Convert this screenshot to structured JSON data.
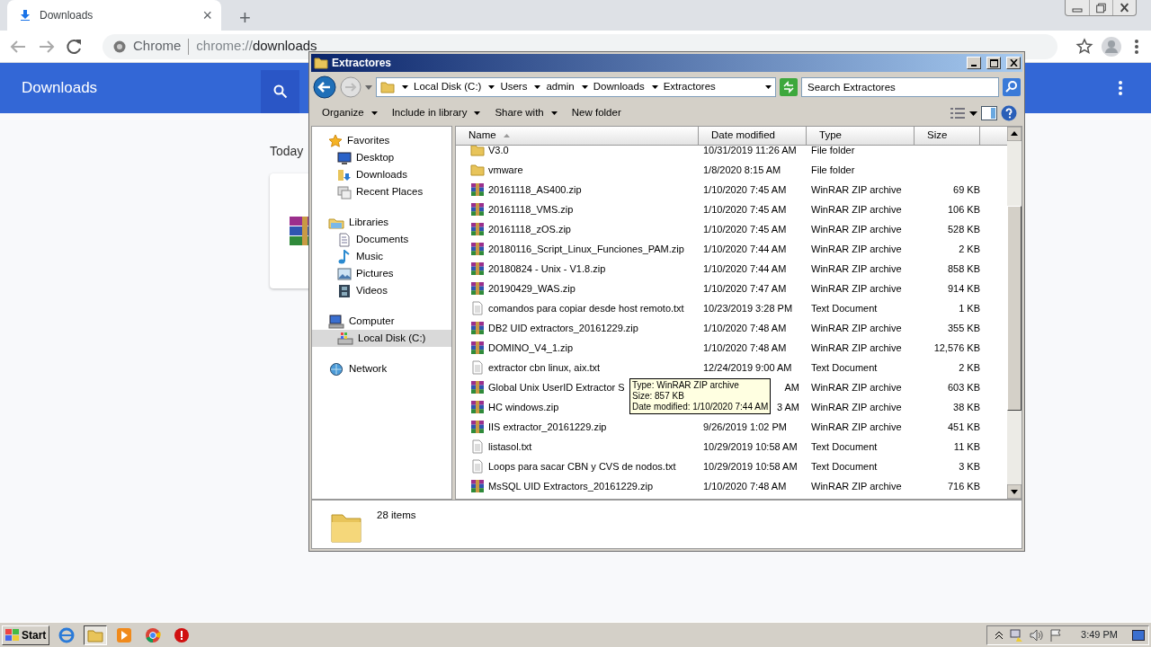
{
  "browser": {
    "tab": {
      "title": "Downloads",
      "close": "×"
    },
    "new_tab": "+",
    "omnibox": {
      "site_label": "Chrome",
      "url_scheme": "chrome://",
      "url_path": "downloads"
    },
    "page_title": "Downloads",
    "section": "Today"
  },
  "explorer": {
    "title": "Extractores",
    "breadcrumbs": [
      "Local Disk (C:)",
      "Users",
      "admin",
      "Downloads",
      "Extractores"
    ],
    "search": {
      "placeholder": "Search Extractores"
    },
    "toolbar": [
      {
        "label": "Organize",
        "dropdown": true
      },
      {
        "label": "Include in library",
        "dropdown": true
      },
      {
        "label": "Share with",
        "dropdown": true
      },
      {
        "label": "New folder",
        "dropdown": false
      }
    ],
    "nav": [
      {
        "label": "Favorites",
        "kind": "star",
        "children": [
          {
            "label": "Desktop",
            "kind": "desktop",
            "selected": false
          },
          {
            "label": "Downloads",
            "kind": "downloads",
            "selected": false
          },
          {
            "label": "Recent Places",
            "kind": "recent",
            "selected": false
          }
        ]
      },
      {
        "label": "Libraries",
        "kind": "libraries",
        "children": [
          {
            "label": "Documents",
            "kind": "document",
            "selected": false
          },
          {
            "label": "Music",
            "kind": "music",
            "selected": false
          },
          {
            "label": "Pictures",
            "kind": "pictures",
            "selected": false
          },
          {
            "label": "Videos",
            "kind": "videos",
            "selected": false
          }
        ]
      },
      {
        "label": "Computer",
        "kind": "computer",
        "children": [
          {
            "label": "Local Disk (C:)",
            "kind": "disk",
            "selected": true
          }
        ]
      },
      {
        "label": "Network",
        "kind": "network"
      }
    ],
    "columns": [
      "Name",
      "Date modified",
      "Type",
      "Size"
    ],
    "rows": [
      {
        "kind": "folder",
        "name": "V3.0",
        "date": "10/31/2019 11:26 AM",
        "type": "File folder"
      },
      {
        "kind": "folder",
        "name": "vmware",
        "date": "1/8/2020 8:15 AM",
        "type": "File folder"
      },
      {
        "kind": "zip",
        "name": "20161118_AS400.zip",
        "date": "1/10/2020 7:45 AM",
        "type": "WinRAR ZIP archive",
        "size": "69 KB"
      },
      {
        "kind": "zip",
        "name": "20161118_VMS.zip",
        "date": "1/10/2020 7:45 AM",
        "type": "WinRAR ZIP archive",
        "size": "106 KB"
      },
      {
        "kind": "zip",
        "name": "20161118_zOS.zip",
        "date": "1/10/2020 7:45 AM",
        "type": "WinRAR ZIP archive",
        "size": "528 KB"
      },
      {
        "kind": "zip",
        "name": "20180116_Script_Linux_Funciones_PAM.zip",
        "date": "1/10/2020 7:44 AM",
        "type": "WinRAR ZIP archive",
        "size": "2 KB"
      },
      {
        "kind": "zip",
        "name": "20180824 - Unix - V1.8.zip",
        "date": "1/10/2020 7:44 AM",
        "type": "WinRAR ZIP archive",
        "size": "858 KB"
      },
      {
        "kind": "zip",
        "name": "20190429_WAS.zip",
        "date": "1/10/2020 7:47 AM",
        "type": "WinRAR ZIP archive",
        "size": "914 KB"
      },
      {
        "kind": "txt",
        "name": "comandos para copiar desde host remoto.txt",
        "date": "10/23/2019 3:28 PM",
        "type": "Text Document",
        "size": "1 KB"
      },
      {
        "kind": "zip",
        "name": "DB2 UID extractors_20161229.zip",
        "date": "1/10/2020 7:48 AM",
        "type": "WinRAR ZIP archive",
        "size": "355 KB"
      },
      {
        "kind": "zip",
        "name": "DOMINO_V4_1.zip",
        "date": "1/10/2020 7:48 AM",
        "type": "WinRAR ZIP archive",
        "size": "12,576 KB"
      },
      {
        "kind": "txt",
        "name": "extractor cbn linux, aix.txt",
        "date": "12/24/2019 9:00 AM",
        "type": "Text Document",
        "size": "2 KB"
      },
      {
        "kind": "zip",
        "name": "Global Unix UserID Extractor S",
        "date": "AM",
        "date_clipped": true,
        "type": "WinRAR ZIP archive",
        "size": "603 KB"
      },
      {
        "kind": "zip",
        "name": "HC windows.zip",
        "date": "3 AM",
        "date_clipped": true,
        "type": "WinRAR ZIP archive",
        "size": "38 KB"
      },
      {
        "kind": "zip",
        "name": "IIS extractor_20161229.zip",
        "date": "9/26/2019 1:02 PM",
        "type": "WinRAR ZIP archive",
        "size": "451 KB"
      },
      {
        "kind": "txt",
        "name": "listasol.txt",
        "date": "10/29/2019 10:58 AM",
        "type": "Text Document",
        "size": "11 KB"
      },
      {
        "kind": "txt",
        "name": "Loops para sacar CBN y CVS de nodos.txt",
        "date": "10/29/2019 10:58 AM",
        "type": "Text Document",
        "size": "3 KB"
      },
      {
        "kind": "zip",
        "name": "MsSQL UID Extractors_20161229.zip",
        "date": "1/10/2020 7:48 AM",
        "type": "WinRAR ZIP archive",
        "size": "716 KB"
      }
    ],
    "tooltip": [
      "Type: WinRAR ZIP archive",
      "Size: 857 KB",
      "Date modified: 1/10/2020 7:44 AM"
    ],
    "status": "28 items"
  },
  "taskbar": {
    "start": "Start",
    "clock": "3:49 PM"
  }
}
